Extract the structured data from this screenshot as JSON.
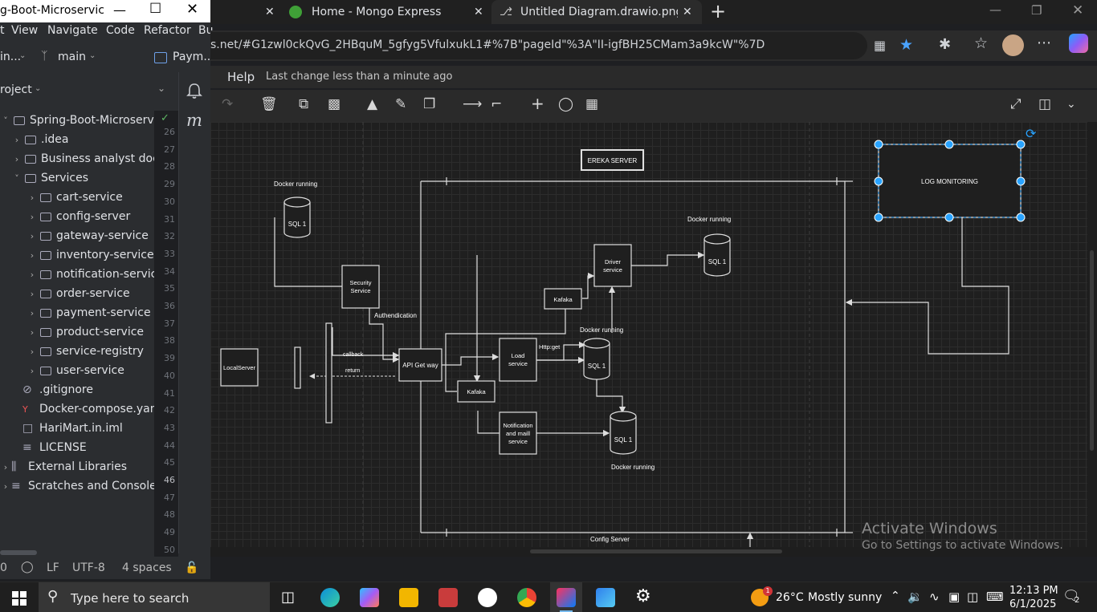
{
  "intellij": {
    "title": "g-Boot-Microservic",
    "menu": [
      "t",
      "View",
      "Navigate",
      "Code",
      "Refactor",
      "Bu"
    ],
    "toolbar": {
      "project_short": "in...",
      "branch": "main",
      "run_config": "Paym..."
    },
    "project_header": "roject",
    "tree": [
      {
        "label": "Spring-Boot-Microservic",
        "type": "folder",
        "depth": 0,
        "expanded": true
      },
      {
        "label": ".idea",
        "type": "folder",
        "depth": 1,
        "expanded": false
      },
      {
        "label": "Business analyst docu",
        "type": "folder",
        "depth": 1,
        "expanded": false
      },
      {
        "label": "Services",
        "type": "folder",
        "depth": 1,
        "expanded": true
      },
      {
        "label": "cart-service",
        "type": "module",
        "depth": 2,
        "expanded": false
      },
      {
        "label": "config-server",
        "type": "module",
        "depth": 2,
        "expanded": false
      },
      {
        "label": "gateway-service",
        "type": "module",
        "depth": 2,
        "expanded": false
      },
      {
        "label": "inventory-service",
        "type": "module",
        "depth": 2,
        "expanded": false
      },
      {
        "label": "notification-service",
        "type": "module",
        "depth": 2,
        "expanded": false
      },
      {
        "label": "order-service",
        "type": "module",
        "depth": 2,
        "expanded": false
      },
      {
        "label": "payment-service",
        "type": "module",
        "depth": 2,
        "expanded": false
      },
      {
        "label": "product-service",
        "type": "module",
        "depth": 2,
        "expanded": false
      },
      {
        "label": "service-registry",
        "type": "module",
        "depth": 2,
        "expanded": false
      },
      {
        "label": "user-service",
        "type": "module",
        "depth": 2,
        "expanded": false
      },
      {
        "label": ".gitignore",
        "type": "file",
        "depth": 1
      },
      {
        "label": "Docker-compose.yam",
        "type": "file",
        "depth": 1
      },
      {
        "label": "HariMart.in.iml",
        "type": "file",
        "depth": 1
      },
      {
        "label": "LICENSE",
        "type": "file",
        "depth": 1
      },
      {
        "label": "External Libraries",
        "type": "lib",
        "depth": 0
      },
      {
        "label": "Scratches and Consoles",
        "type": "lib",
        "depth": 0
      }
    ],
    "line_numbers": [
      "26",
      "27",
      "28",
      "29",
      "30",
      "31",
      "32",
      "33",
      "34",
      "35",
      "36",
      "37",
      "38",
      "39",
      "40",
      "41",
      "42",
      "43",
      "44",
      "45",
      "46",
      "47",
      "48",
      "49",
      "50"
    ],
    "status": {
      "col": "0",
      "line_sep": "LF",
      "encoding": "UTF-8",
      "indent": "4 spaces"
    }
  },
  "browser": {
    "tabs": [
      {
        "label": "",
        "active": false
      },
      {
        "label": "Home - Mongo Express",
        "active": false
      },
      {
        "label": "Untitled Diagram.drawio.png - dr",
        "active": true
      }
    ],
    "url": "s.net/#G1zwl0ckQvG_2HBquM_5gfyg5VfulxukL1#%7B\"pageId\"%3A\"II-igfBH25CMam3a9kcW\"%7D"
  },
  "drawio": {
    "menu_help": "Help",
    "last_change": "Last change less than a minute ago"
  },
  "diagram": {
    "nodes": {
      "ereka": "EREKA SERVER",
      "log": "LOG MONITORING",
      "security": "Security Service",
      "api_gateway": "API Get way",
      "local_server": "LocalServer",
      "load": "Load service",
      "driver": "Driver service",
      "kafka1": "Kafaka",
      "kafka2": "Kafaka",
      "notification": "Notification and maill service",
      "sql_top": "SQL 1",
      "sql_driver": "SQL 1",
      "sql_load": "SQL 1",
      "sql_notif": "SQL 1"
    },
    "labels": {
      "docker_top": "Docker running",
      "docker_driver": "Docker running",
      "docker_load": "Docker running",
      "docker_notif": "Docker running",
      "auth": "Authendication",
      "callback": "callback",
      "return": "return",
      "http_get": "Http:get",
      "config_server": "Config Server"
    }
  },
  "watermark": {
    "line1": "Activate Windows",
    "line2": "Go to Settings to activate Windows."
  },
  "taskbar": {
    "search_placeholder": "Type here to search",
    "weather_temp": "26°C",
    "weather_desc": "Mostly sunny",
    "weather_badge": "1",
    "time": "12:13 PM",
    "date": "6/1/2025",
    "notifications": "2"
  }
}
